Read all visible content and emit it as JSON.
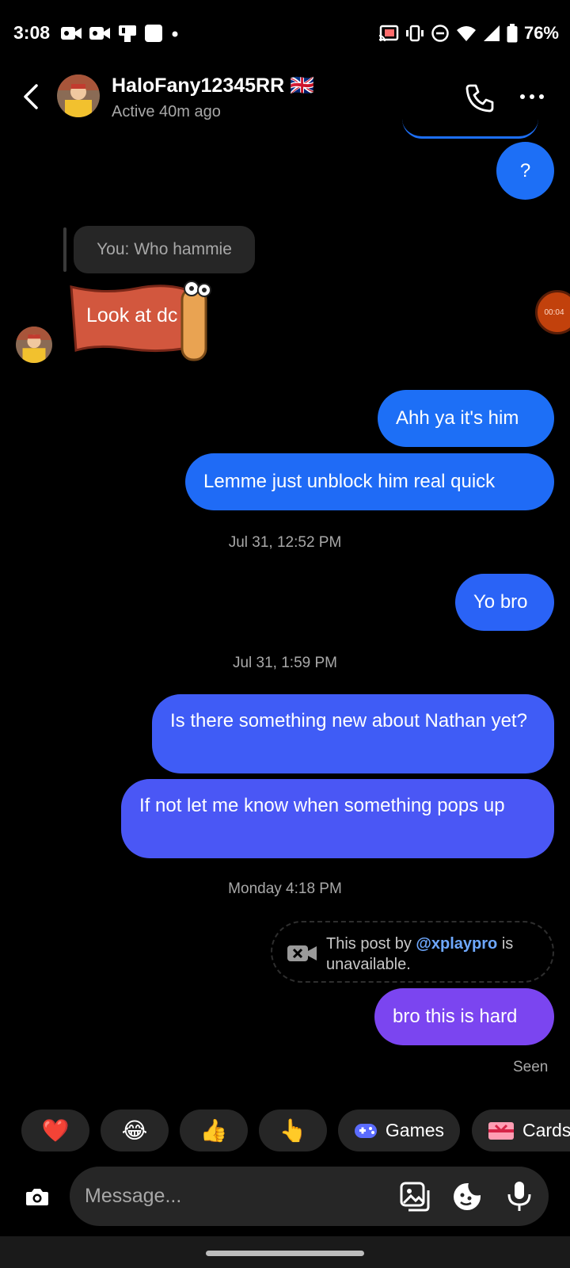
{
  "status_bar": {
    "time": "3:08",
    "battery": "76%",
    "icons_left": [
      "video-camera-icon",
      "video-camera-icon",
      "device-icon",
      "square-icon",
      "dot-icon"
    ],
    "icons_right": [
      "cast-icon",
      "vibrate-icon",
      "do-not-disturb-icon",
      "wifi-icon",
      "signal-icon",
      "battery-icon"
    ]
  },
  "header": {
    "name": "HaloFany12345RR 🇬🇧",
    "status": "Active 40m ago"
  },
  "messages": {
    "q": "?",
    "reply_quote": "You: Who hammie",
    "look_at_dc": "Look at dc",
    "m1": "Ahh ya it's him",
    "m2": "Lemme just unblock him real quick",
    "ts1": "Jul 31, 12:52 PM",
    "m3": "Yo bro",
    "ts2": "Jul 31, 1:59 PM",
    "m4": "Is there something new about Nathan yet?",
    "m5": "If not let me know when something pops up",
    "ts3": "Monday 4:18 PM",
    "unavailable_prefix": "This post by ",
    "unavailable_handle": "@xplaypro",
    "unavailable_suffix": " is unavailable.",
    "m6": "bro this is hard",
    "seen": "Seen"
  },
  "floating_timer": "00:04",
  "quick_bar": {
    "heart": "❤️",
    "laugh": "😂",
    "thumbs": "👍",
    "point": "👆",
    "games": "Games",
    "cards": "Cards"
  },
  "composer": {
    "placeholder": "Message..."
  },
  "colors": {
    "bubble_blue": "#1d6ff6",
    "bubble_violet": "#4a57f5",
    "bubble_purple": "#7b45f0",
    "received_dark": "#262626",
    "link": "#6ea8ff"
  }
}
